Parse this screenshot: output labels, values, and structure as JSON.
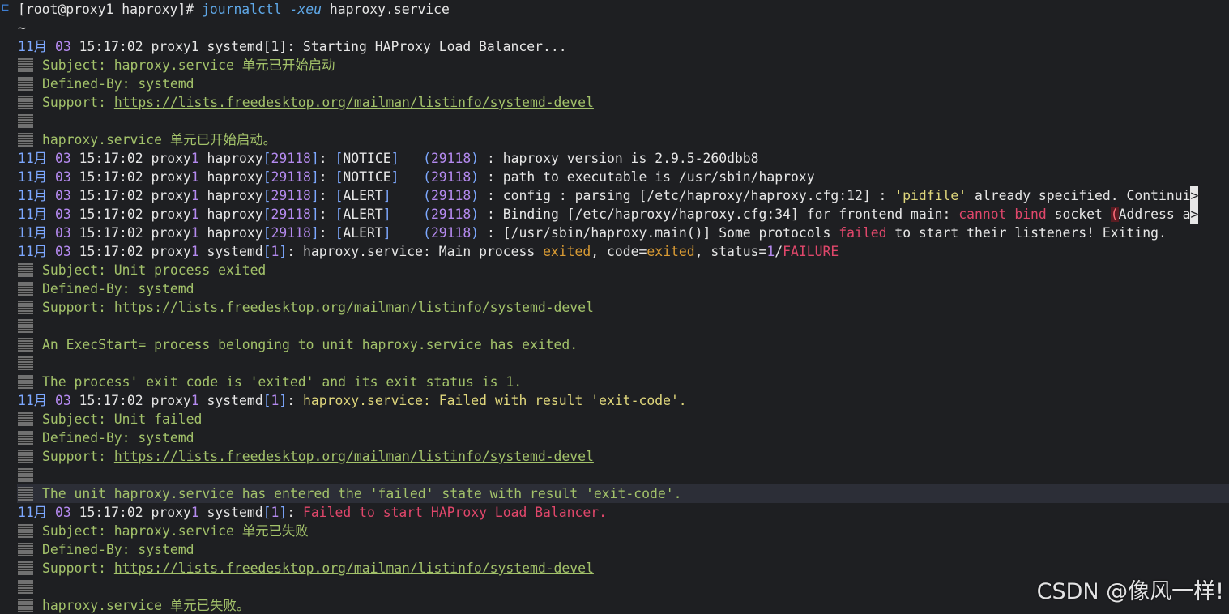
{
  "prompt": {
    "text": "[root@proxy1 haproxy]# ",
    "cmd": "journalctl",
    "opt": "-xeu",
    "arg": "haproxy.service"
  },
  "tilde": "~",
  "ts": {
    "mon": "11月",
    "day": "03",
    "time": "15:17:02"
  },
  "url": "https://lists.freedesktop.org/mailman/listinfo/systemd-devel",
  "defined_by": "Defined-By: systemd",
  "support_label": "Support: ",
  "b1": {
    "rest": " proxy1 systemd[1]: Starting HAProxy Load Balancer...",
    "subject": "Subject: haproxy.service 单元已开始启动",
    "body": "haproxy.service 单元已开始启动。"
  },
  "h1": {
    "pre": " proxy1 haproxy[29118]: [NOTICE]   (29118) : ",
    "msg": "haproxy version is 2.9.5-260dbb8"
  },
  "h2": {
    "pre": " proxy1 haproxy[29118]: [NOTICE]   (29118) : ",
    "msg": "path to executable is /usr/sbin/haproxy"
  },
  "h3": {
    "pre": " proxy1 haproxy[29118]: [ALERT]    (29118) : ",
    "msg": "config : parsing [/etc/haproxy/haproxy.cfg:12] : ",
    "pidfile": "'pidfile'",
    "tail": " already specified. Continui",
    "more": ">"
  },
  "h4": {
    "pre": " proxy1 haproxy[29118]: [ALERT]    (29118) : ",
    "a": "Binding [/etc/haproxy/haproxy.cfg:34] for frontend main: ",
    "cannot": "cannot bind",
    "b": " socket ",
    "paren": "(",
    "c": "Address a",
    "more": ">"
  },
  "h5": {
    "pre": " proxy1 haproxy[29118]: [ALERT]    (29118) : ",
    "a": "[/usr/sbin/haproxy.main()] Some protocols ",
    "failed": "failed",
    "b": " to start their listeners! Exiting."
  },
  "b2": {
    "pre": " proxy1 systemd[1]: ",
    "a": "haproxy.service: Main process ",
    "exited": "exited",
    "b": ", code=",
    "exited2": "exited",
    "c": ", status=",
    "one": "1",
    "slash": "/",
    "failure": "FAILURE",
    "subject": "Subject: Unit process exited",
    "body1": "An ExecStart= process belonging to unit haproxy.service has exited.",
    "body2": "The process' exit code is 'exited' and its exit status is 1."
  },
  "b3": {
    "pre": " proxy1 systemd[1]: ",
    "msg": "haproxy.service: Failed with result 'exit-code'.",
    "subject": "Subject: Unit failed",
    "body": "The unit haproxy.service has entered the 'failed' state with result 'exit-code'."
  },
  "b4": {
    "pre": " proxy1 systemd[1]: ",
    "msg": "Failed to start HAProxy Load Balancer.",
    "subject": "Subject: haproxy.service 单元已失败",
    "body": "haproxy.service 单元已失败。"
  },
  "watermark": "CSDN @像风一样!"
}
